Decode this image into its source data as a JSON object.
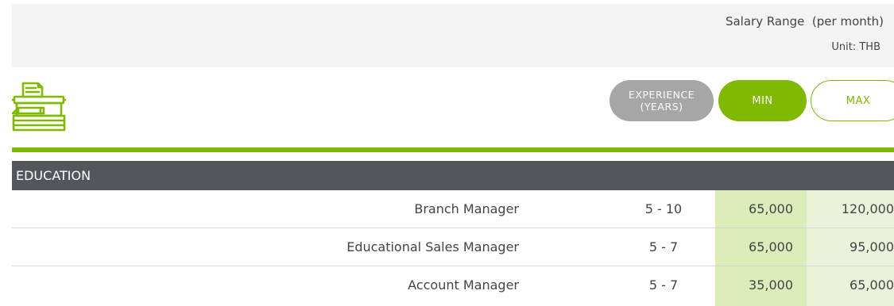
{
  "header": {
    "salary_range": "Salary Range  (per month)",
    "unit": "Unit: THB"
  },
  "icon": {
    "name": "typewriter-icon"
  },
  "columns": {
    "experience_line1": "EXPERIENCE",
    "experience_line2": "(YEARS)",
    "min": "MIN",
    "max": "MAX"
  },
  "category": "EDUCATION",
  "colors": {
    "accent_green": "#7fba00",
    "category_bar": "#53565b",
    "pill_gray": "#a6a6a6",
    "min_column": "#dbecb8",
    "max_column": "#eaf3da"
  },
  "rows": [
    {
      "position": "Branch Manager",
      "experience": "5 - 10",
      "min": "65,000",
      "max": "120,000"
    },
    {
      "position": "Educational Sales Manager",
      "experience": "5 - 7",
      "min": "65,000",
      "max": "95,000"
    },
    {
      "position": "Account Manager",
      "experience": "5 - 7",
      "min": "35,000",
      "max": "65,000"
    }
  ]
}
